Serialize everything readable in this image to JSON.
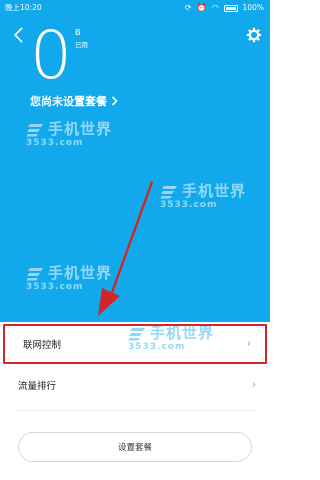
{
  "status_bar": {
    "time": "晚上10:20",
    "battery": "100%"
  },
  "header": {
    "usage_value": "0",
    "usage_unit": "B",
    "usage_caption": "已用",
    "plan_link_label": "您尚未设置套餐"
  },
  "watermark": {
    "title": "手机世界",
    "subtitle": "3533.com"
  },
  "list": {
    "items": [
      {
        "label": "联网控制"
      },
      {
        "label": "流量排行"
      }
    ]
  },
  "footer": {
    "button_label": "设置套餐"
  },
  "colors": {
    "primary": "#12a9ec",
    "highlight": "#d0262a"
  }
}
